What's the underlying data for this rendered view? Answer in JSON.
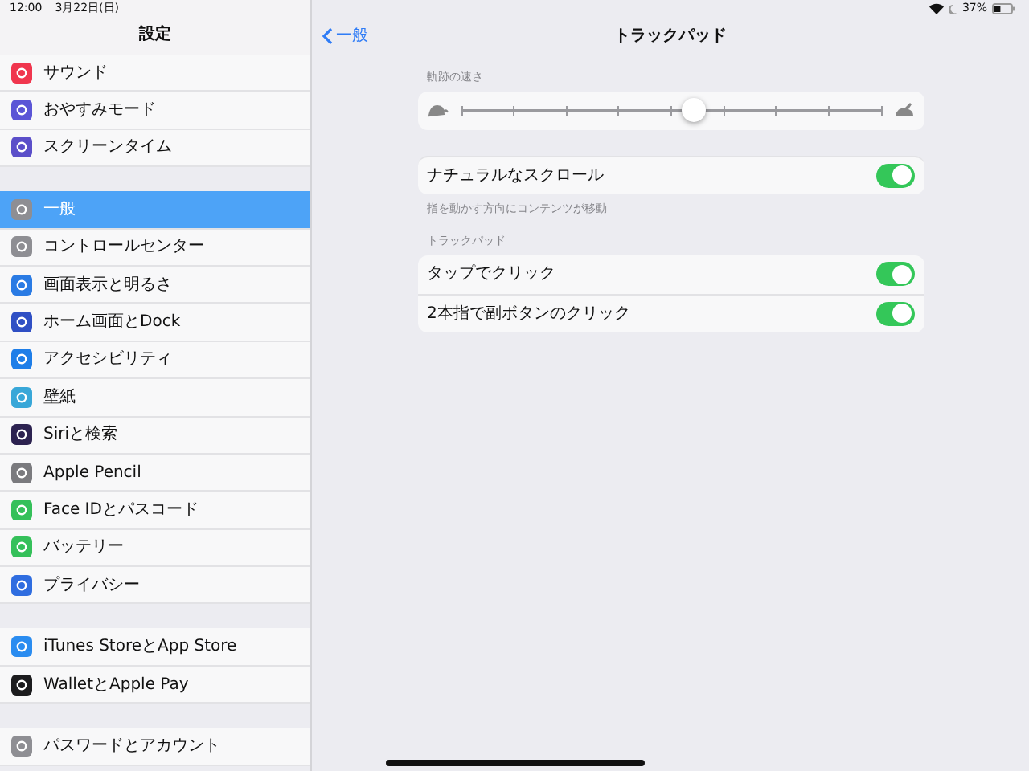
{
  "status_bar": {
    "time": "12:00",
    "date": "3月22日(日)",
    "battery": "37%"
  },
  "sidebar": {
    "title": "設定",
    "groups": [
      {
        "items": [
          {
            "label": "サウンド",
            "color": "#f0364e",
            "selected": false
          },
          {
            "label": "おやすみモード",
            "color": "#5b55d6",
            "selected": false
          },
          {
            "label": "スクリーンタイム",
            "color": "#5b4fc9",
            "selected": false
          }
        ]
      },
      {
        "items": [
          {
            "label": "一般",
            "color": "#8e8e93",
            "selected": true
          },
          {
            "label": "コントロールセンター",
            "color": "#8e8e93",
            "selected": false
          },
          {
            "label": "画面表示と明るさ",
            "color": "#2a7be4",
            "selected": false
          },
          {
            "label": "ホーム画面とDock",
            "color": "#2f4fc4",
            "selected": false
          },
          {
            "label": "アクセシビリティ",
            "color": "#1e7ee8",
            "selected": false
          },
          {
            "label": "壁紙",
            "color": "#38a7d8",
            "selected": false
          },
          {
            "label": "Siriと検索",
            "color": "#2c2250",
            "selected": false
          },
          {
            "label": "Apple Pencil",
            "color": "#7a7a7e",
            "selected": false
          },
          {
            "label": "Face IDとパスコード",
            "color": "#35c05a",
            "selected": false
          },
          {
            "label": "バッテリー",
            "color": "#35c05a",
            "selected": false
          },
          {
            "label": "プライバシー",
            "color": "#2f6de0",
            "selected": false
          }
        ]
      },
      {
        "items": [
          {
            "label": "iTunes StoreとApp Store",
            "color": "#2a8cf0",
            "selected": false
          },
          {
            "label": "WalletとApple Pay",
            "color": "#1c1c1e",
            "selected": false
          }
        ]
      },
      {
        "items": [
          {
            "label": "パスワードとアカウント",
            "color": "#8e8e93",
            "selected": false
          }
        ]
      }
    ]
  },
  "detail": {
    "back": "一般",
    "title": "トラックパッド",
    "speed": {
      "label": "軌跡の速さ",
      "level": 0.555
    },
    "natural_scroll": {
      "label": "ナチュラルなスクロール",
      "on": true
    },
    "natural_scroll_footer": "指を動かす方向にコンテンツが移動",
    "section": "トラックパッド",
    "toggles": [
      {
        "label": "タップでクリック",
        "on": true
      },
      {
        "label": "2本指で副ボタンのクリック",
        "on": true
      }
    ]
  }
}
